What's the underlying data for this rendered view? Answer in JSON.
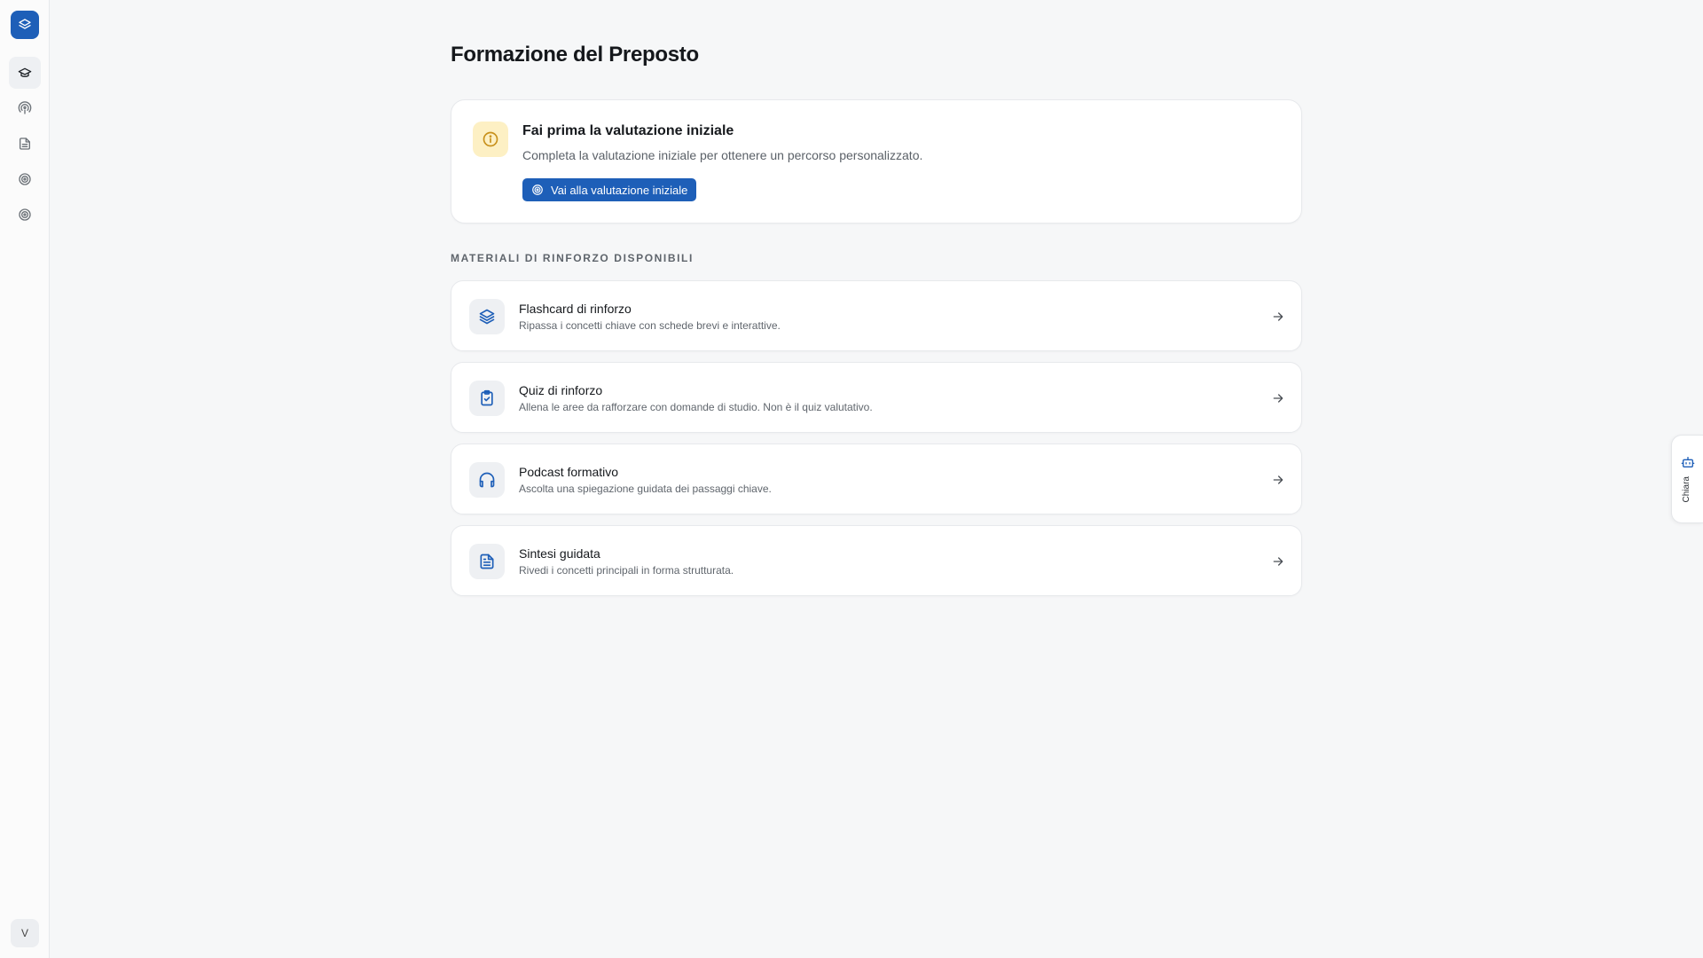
{
  "sidebar": {
    "logo_icon": "layers-icon",
    "items": [
      {
        "name": "graduation-cap-icon",
        "active": true
      },
      {
        "name": "podcast-icon",
        "active": false
      },
      {
        "name": "document-icon",
        "active": false
      },
      {
        "name": "target-icon",
        "active": false
      },
      {
        "name": "target-icon",
        "active": false
      }
    ],
    "user_initial": "V"
  },
  "page": {
    "title": "Formazione del Preposto"
  },
  "notice": {
    "icon": "info-icon",
    "title": "Fai prima la valutazione iniziale",
    "description": "Completa la valutazione iniziale per ottenere un percorso personalizzato.",
    "button_label": "Vai alla valutazione iniziale",
    "button_icon": "target-icon"
  },
  "materials": {
    "section_label": "MATERIALI DI RINFORZO DISPONIBILI",
    "items": [
      {
        "icon": "layers-icon",
        "title": "Flashcard di rinforzo",
        "description": "Ripassa i concetti chiave con schede brevi e interattive."
      },
      {
        "icon": "clipboard-check-icon",
        "title": "Quiz di rinforzo",
        "description": "Allena le aree da rafforzare con domande di studio. Non è il quiz valutativo."
      },
      {
        "icon": "headphones-icon",
        "title": "Podcast formativo",
        "description": "Ascolta una spiegazione guidata dei passaggi chiave."
      },
      {
        "icon": "file-text-icon",
        "title": "Sintesi guidata",
        "description": "Rivedi i concetti principali in forma strutturata."
      }
    ]
  },
  "assistant": {
    "label": "Chiara",
    "icon": "bot-icon"
  },
  "colors": {
    "accent": "#1e5fb8",
    "notice_bg": "#fdf0c4",
    "notice_icon": "#c8901a",
    "background": "#f6f7f8"
  }
}
